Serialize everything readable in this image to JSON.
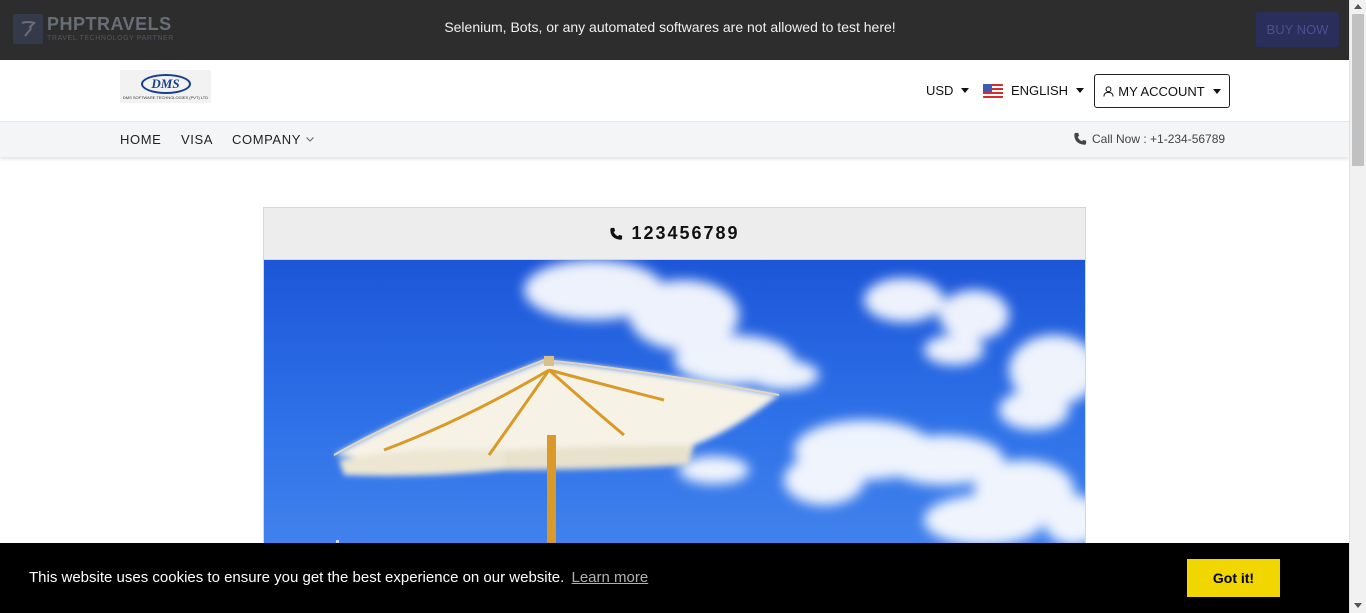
{
  "topbar": {
    "brand_name": "PHPTRAVELS",
    "brand_tagline": "TRAVEL TECHNOLOGY PARTNER",
    "notice": "Selenium, Bots, or any automated softwares are not allowed to test here!",
    "buy_now_label": "BUY NOW"
  },
  "header": {
    "logo_text": "DMS",
    "logo_subtext": "DMS SOFTWARE TECHNOLOGIES (PVT) LTD",
    "currency": "USD",
    "language": "ENGLISH",
    "account_label": "MY ACCOUNT"
  },
  "nav": {
    "items": [
      {
        "label": "HOME"
      },
      {
        "label": "VISA"
      },
      {
        "label": "COMPANY"
      }
    ],
    "call_label": "Call Now : +1-234-56789"
  },
  "card": {
    "phone": "123456789"
  },
  "cookie": {
    "message": "This website uses cookies to ensure you get the best experience on our website.",
    "learn_more": "Learn more",
    "accept_label": "Got it!"
  },
  "icons": {
    "brand": "phptravels-logo-icon",
    "phone": "phone-icon",
    "user": "user-icon",
    "flag": "us-flag-icon"
  },
  "colors": {
    "topbar_bg": "#2d2d2d",
    "buy_now_bg": "#2a2e5a",
    "accept_bg": "#f1d600",
    "logo_blue": "#1b3f8f"
  }
}
